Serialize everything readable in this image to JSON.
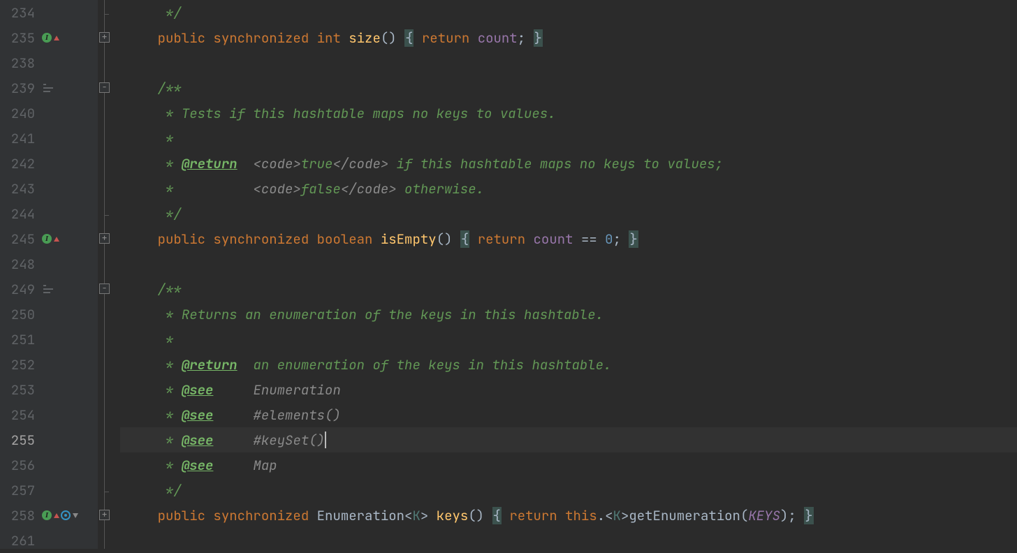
{
  "editor": {
    "current_line": 255,
    "gutter": [
      {
        "n": 234,
        "icons": [],
        "fold": "end"
      },
      {
        "n": 235,
        "icons": [
          "impl-up"
        ],
        "fold": "plus"
      },
      {
        "n": 238,
        "icons": [],
        "fold": ""
      },
      {
        "n": 239,
        "icons": [
          "render"
        ],
        "fold": "minus"
      },
      {
        "n": 240,
        "icons": [],
        "fold": ""
      },
      {
        "n": 241,
        "icons": [],
        "fold": ""
      },
      {
        "n": 242,
        "icons": [],
        "fold": ""
      },
      {
        "n": 243,
        "icons": [],
        "fold": ""
      },
      {
        "n": 244,
        "icons": [],
        "fold": "end"
      },
      {
        "n": 245,
        "icons": [
          "impl-up"
        ],
        "fold": "plus"
      },
      {
        "n": 248,
        "icons": [],
        "fold": ""
      },
      {
        "n": 249,
        "icons": [
          "render"
        ],
        "fold": "minus"
      },
      {
        "n": 250,
        "icons": [],
        "fold": ""
      },
      {
        "n": 251,
        "icons": [],
        "fold": ""
      },
      {
        "n": 252,
        "icons": [],
        "fold": ""
      },
      {
        "n": 253,
        "icons": [],
        "fold": ""
      },
      {
        "n": 254,
        "icons": [],
        "fold": ""
      },
      {
        "n": 255,
        "icons": [],
        "fold": ""
      },
      {
        "n": 256,
        "icons": [],
        "fold": ""
      },
      {
        "n": 257,
        "icons": [],
        "fold": "end"
      },
      {
        "n": 258,
        "icons": [
          "impl-up",
          "override-down"
        ],
        "fold": "plus"
      },
      {
        "n": 261,
        "icons": [],
        "fold": ""
      }
    ],
    "lines": {
      "l234": {
        "indent": "     ",
        "t": "*/"
      },
      "l235": {
        "indent": "    ",
        "kw_public": "public",
        "sp1": " ",
        "kw_sync": "synchronized",
        "sp2": " ",
        "kw_int": "int",
        "sp3": " ",
        "method": "size",
        "paren": "()",
        "sp4": " ",
        "lb": "{",
        "sp5": " ",
        "kw_return": "return",
        "sp6": " ",
        "field": "count",
        "semi": ";",
        "sp7": " ",
        "rb": "}"
      },
      "l238": {
        "indent": ""
      },
      "l239": {
        "indent": "    ",
        "t": "/**"
      },
      "l240": {
        "indent": "     ",
        "a": "* ",
        "t": "Tests if this hashtable maps no keys to values."
      },
      "l241": {
        "indent": "     ",
        "t": "*"
      },
      "l242": {
        "indent": "     ",
        "a": "* ",
        "tag": "@return",
        "sp": "  ",
        "o": "<code>",
        "v": "true",
        "c": "</code>",
        "rest": " if this hashtable maps no keys to values;"
      },
      "l243": {
        "indent": "     ",
        "a": "*          ",
        "o": "<code>",
        "v": "false",
        "c": "</code>",
        "rest": " otherwise."
      },
      "l244": {
        "indent": "     ",
        "t": "*/"
      },
      "l245": {
        "indent": "    ",
        "kw_public": "public",
        "sp1": " ",
        "kw_sync": "synchronized",
        "sp2": " ",
        "kw_bool": "boolean",
        "sp3": " ",
        "method": "isEmpty",
        "paren": "()",
        "sp4": " ",
        "lb": "{",
        "sp5": " ",
        "kw_return": "return",
        "sp6": " ",
        "field": "count",
        "sp7": " ",
        "op": "==",
        "sp8": " ",
        "zero": "0",
        "semi": ";",
        "sp9": " ",
        "rb": "}"
      },
      "l248": {
        "indent": ""
      },
      "l249": {
        "indent": "    ",
        "t": "/**"
      },
      "l250": {
        "indent": "     ",
        "a": "* ",
        "t": "Returns an enumeration of the keys in this hashtable."
      },
      "l251": {
        "indent": "     ",
        "t": "*"
      },
      "l252": {
        "indent": "     ",
        "a": "* ",
        "tag": "@return",
        "sp": "  ",
        "rest": "an enumeration of the keys in this hashtable."
      },
      "l253": {
        "indent": "     ",
        "a": "* ",
        "tag": "@see",
        "sp": "     ",
        "rest": "Enumeration"
      },
      "l254": {
        "indent": "     ",
        "a": "* ",
        "tag": "@see",
        "sp": "     ",
        "rest": "#elements()"
      },
      "l255": {
        "indent": "     ",
        "a": "* ",
        "tag": "@see",
        "sp": "     ",
        "rest": "#keySet()"
      },
      "l256": {
        "indent": "     ",
        "a": "* ",
        "tag": "@see",
        "sp": "     ",
        "rest": "Map"
      },
      "l257": {
        "indent": "     ",
        "t": "*/"
      },
      "l258": {
        "indent": "    ",
        "kw_public": "public",
        "sp1": " ",
        "kw_sync": "synchronized",
        "sp2": " ",
        "type": "Enumeration",
        "lt": "<",
        "gen": "K",
        "gt": ">",
        "sp3": " ",
        "method": "keys",
        "paren": "()",
        "sp4": " ",
        "lb": "{",
        "sp5": " ",
        "kw_return": "return",
        "sp6": " ",
        "kw_this": "this",
        "dot": ".",
        "lt2": "<",
        "gen2": "K",
        "gt2": ">",
        "call": "getEnumeration",
        "lp": "(",
        "arg": "KEYS",
        "rp": ")",
        "semi": ";",
        "sp7": " ",
        "rb": "}"
      },
      "l261": {
        "indent": ""
      }
    }
  }
}
